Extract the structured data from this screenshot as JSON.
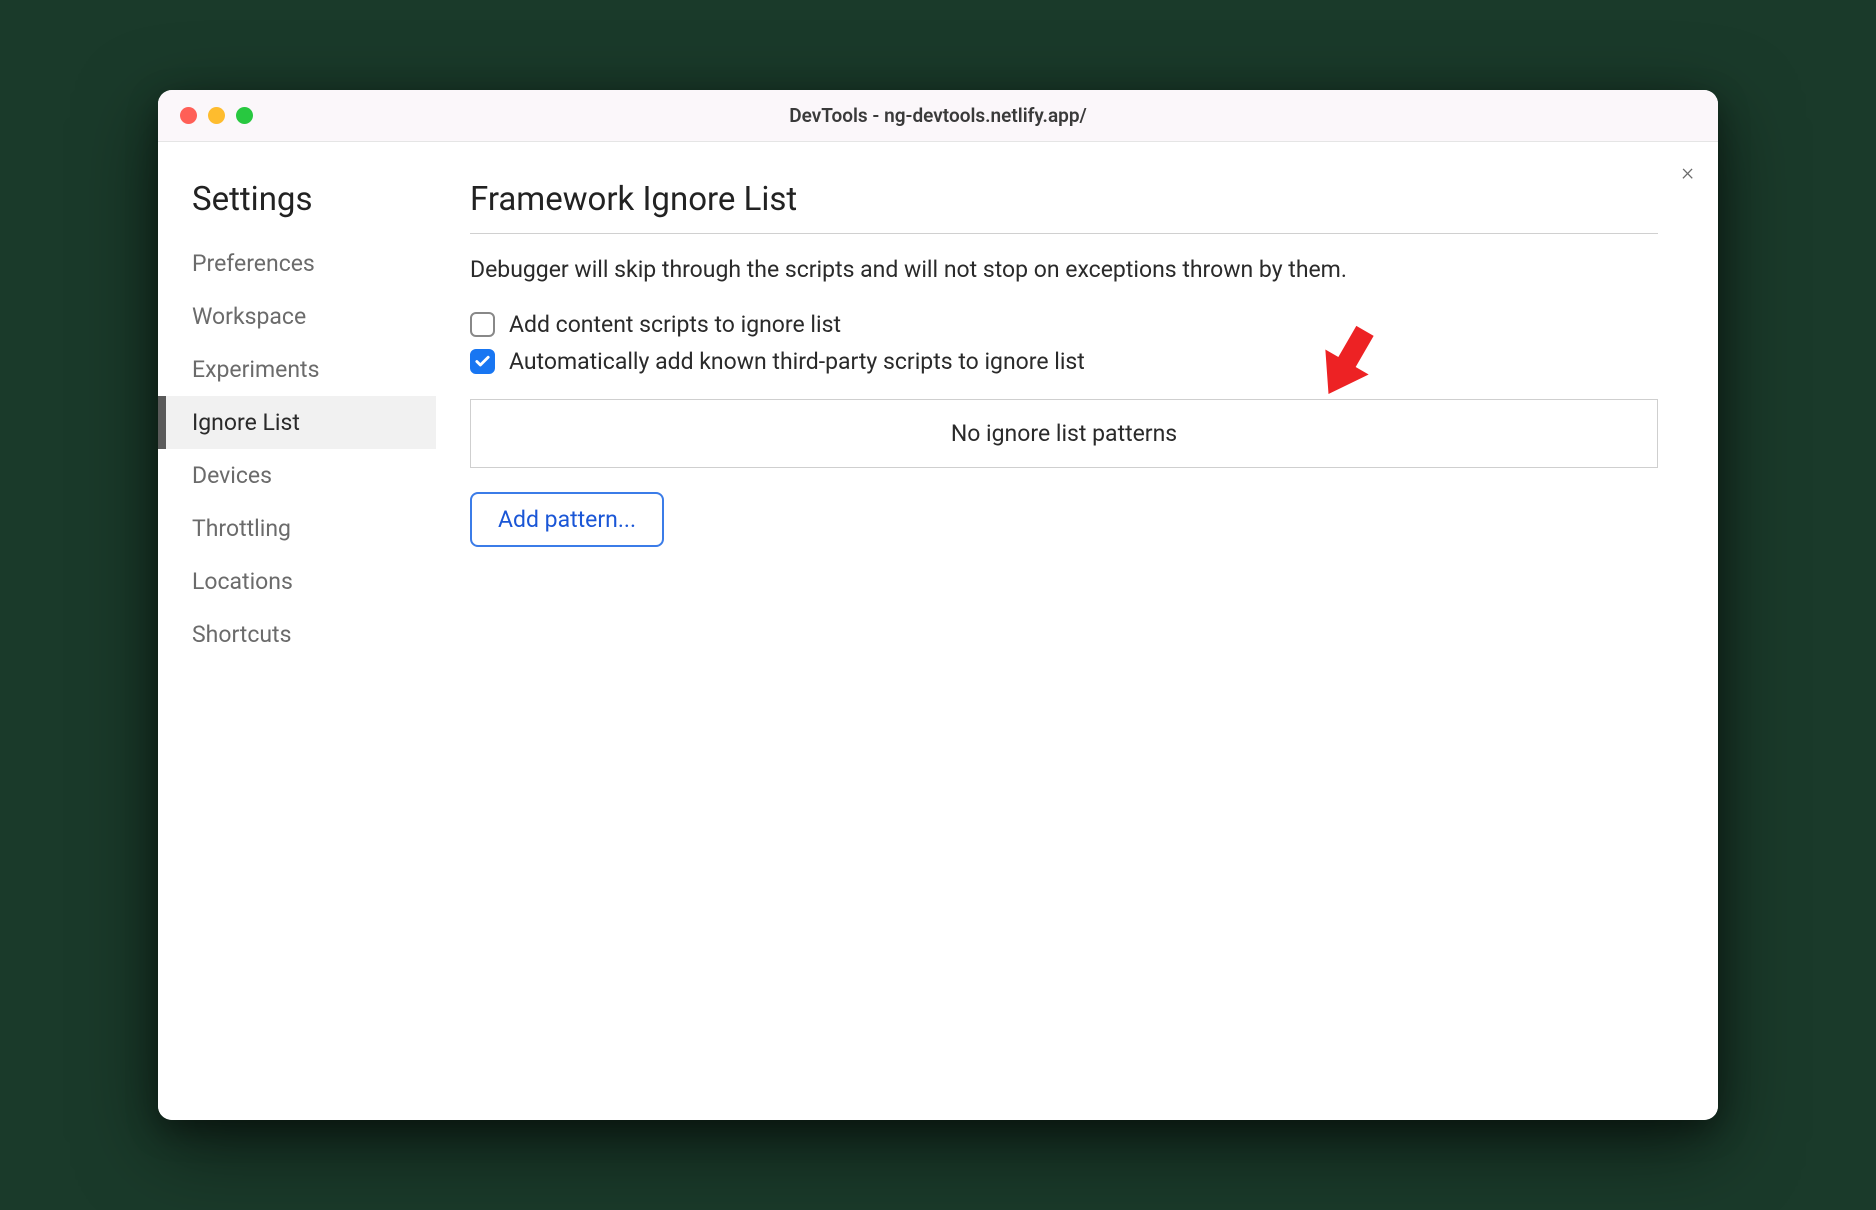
{
  "window": {
    "title": "DevTools - ng-devtools.netlify.app/"
  },
  "sidebar": {
    "title": "Settings",
    "items": [
      {
        "label": "Preferences",
        "active": false
      },
      {
        "label": "Workspace",
        "active": false
      },
      {
        "label": "Experiments",
        "active": false
      },
      {
        "label": "Ignore List",
        "active": true
      },
      {
        "label": "Devices",
        "active": false
      },
      {
        "label": "Throttling",
        "active": false
      },
      {
        "label": "Locations",
        "active": false
      },
      {
        "label": "Shortcuts",
        "active": false
      }
    ]
  },
  "main": {
    "title": "Framework Ignore List",
    "description": "Debugger will skip through the scripts and will not stop on exceptions thrown by them.",
    "checkboxes": [
      {
        "label": "Add content scripts to ignore list",
        "checked": false
      },
      {
        "label": "Automatically add known third-party scripts to ignore list",
        "checked": true
      }
    ],
    "list_empty_text": "No ignore list patterns",
    "add_pattern_label": "Add pattern..."
  },
  "close_label": "×"
}
